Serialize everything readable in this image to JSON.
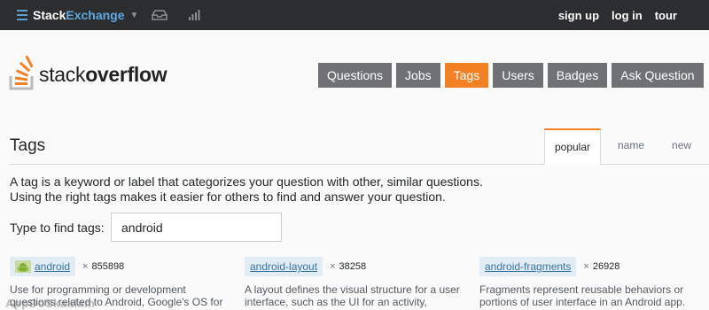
{
  "topbar": {
    "brand_stack": "Stack",
    "brand_exchange": "Exchange",
    "caret": "▼",
    "inbox_icon": "inbox-icon",
    "achievements_icon": "achievements-icon",
    "links": [
      "sign up",
      "log in",
      "tour"
    ],
    "brand_color": "#5ea9e2"
  },
  "header": {
    "logo_light": "stack",
    "logo_bold": "overflow",
    "nav": [
      {
        "label": "Questions",
        "active": false
      },
      {
        "label": "Jobs",
        "active": false
      },
      {
        "label": "Tags",
        "active": true
      },
      {
        "label": "Users",
        "active": false
      },
      {
        "label": "Badges",
        "active": false
      },
      {
        "label": "Ask Question",
        "active": false
      }
    ],
    "accent": "#f48024"
  },
  "tags_page": {
    "title": "Tags",
    "tabs": [
      {
        "label": "popular",
        "active": true
      },
      {
        "label": "name",
        "active": false
      },
      {
        "label": "new",
        "active": false
      }
    ],
    "intro_line1": "A tag is a keyword or label that categorizes your question with other, similar questions.",
    "intro_line2": "Using the right tags makes it easier for others to find and answer your question.",
    "find_label": "Type to find tags:",
    "find_value": "android"
  },
  "tags": [
    {
      "name": "android",
      "icon": "android-robot-icon",
      "multiplier": "×",
      "count": "855898",
      "excerpt": [
        "Use for programming or development",
        "questions related to Android, Google's OS for"
      ]
    },
    {
      "name": "android-layout",
      "multiplier": "×",
      "count": "38258",
      "excerpt": [
        "A layout defines the visual structure for a user",
        "interface, such as the UI for an activity,"
      ]
    },
    {
      "name": "android-fragments",
      "multiplier": "×",
      "count": "26928",
      "excerpt": [
        "Fragments represent reusable behaviors or",
        "portions of user interface in an Android app."
      ]
    }
  ],
  "watermark": "AppDoSkaalam"
}
